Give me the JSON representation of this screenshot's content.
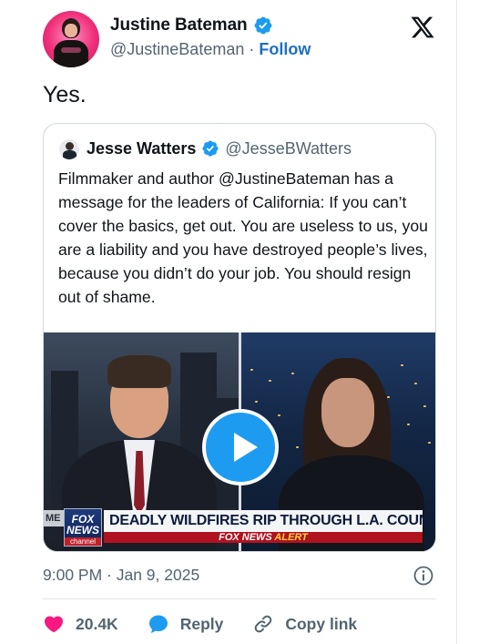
{
  "author": {
    "name": "Justine Bateman",
    "handle": "@JustineBateman",
    "separator": "·",
    "follow_label": "Follow",
    "verified": true
  },
  "tweet": {
    "text": "Yes.",
    "timestamp": "9:00 PM · Jan 9, 2025"
  },
  "quoted": {
    "name": "Jesse Watters",
    "handle": "@JesseBWatters",
    "verified": true,
    "text": "Filmmaker and author @JustineBateman has a message for the leaders of California: If you can’t cover the basics, get out. You are useless to us, you are a liability and you have destroyed people’s lives, because you didn’t do your job. You should resign out of shame.",
    "video": {
      "channel_tag": "ME",
      "logo_line1": "FOX",
      "logo_line2": "NEWS",
      "logo_line3": "channel",
      "headline": "DEADLY WILDFIRES RIP THROUGH L.A. COUNTY",
      "alert_brand": "FOX NEWS",
      "alert_word": "ALERT"
    }
  },
  "actions": {
    "likes": "20.4K",
    "reply_label": "Reply",
    "copy_label": "Copy link"
  },
  "colors": {
    "accent": "#1d9bf0",
    "follow": "#1d6fc4",
    "like": "#f91880",
    "muted": "#536471"
  },
  "icons": [
    "verified-badge-icon",
    "x-logo-icon",
    "play-icon",
    "info-icon",
    "heart-icon",
    "reply-bubble-icon",
    "link-icon"
  ]
}
